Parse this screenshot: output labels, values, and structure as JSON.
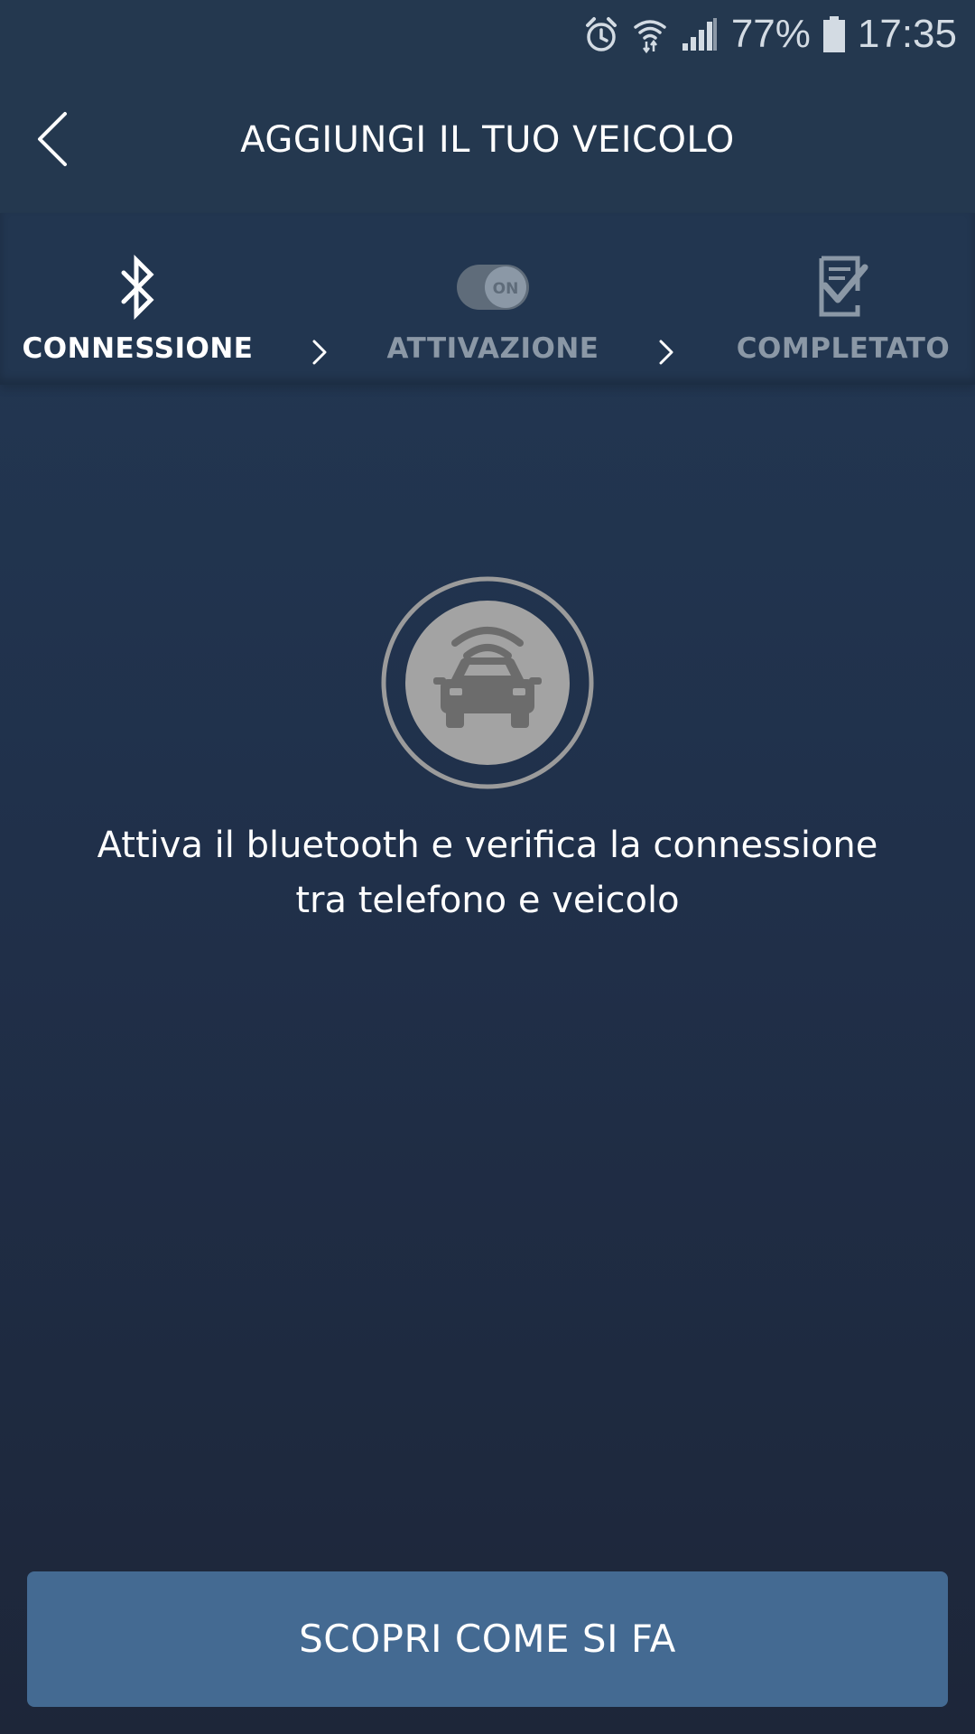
{
  "status_bar": {
    "battery": "77%",
    "time": "17:35"
  },
  "header": {
    "title": "AGGIUNGI IL TUO VEICOLO"
  },
  "stepper": {
    "steps": [
      {
        "label": "CONNESSIONE",
        "icon": "bluetooth-icon",
        "state": "active"
      },
      {
        "label": "ATTIVAZIONE",
        "icon": "toggle-on-icon",
        "state": "inactive",
        "icon_text": "ON"
      },
      {
        "label": "COMPLETATO",
        "icon": "checklist-icon",
        "state": "inactive"
      }
    ]
  },
  "main": {
    "illustration_icon": "connected-car-icon",
    "instruction_line1": "Attiva il bluetooth e verifica la connessione",
    "instruction_line2": "tra telefono e veicolo"
  },
  "cta": {
    "label": "SCOPRI COME SI FA"
  },
  "colors": {
    "background_top": "#233a55",
    "background_bottom": "#1d2639",
    "button": "#446a92",
    "inactive_text": "#8b98a6"
  }
}
